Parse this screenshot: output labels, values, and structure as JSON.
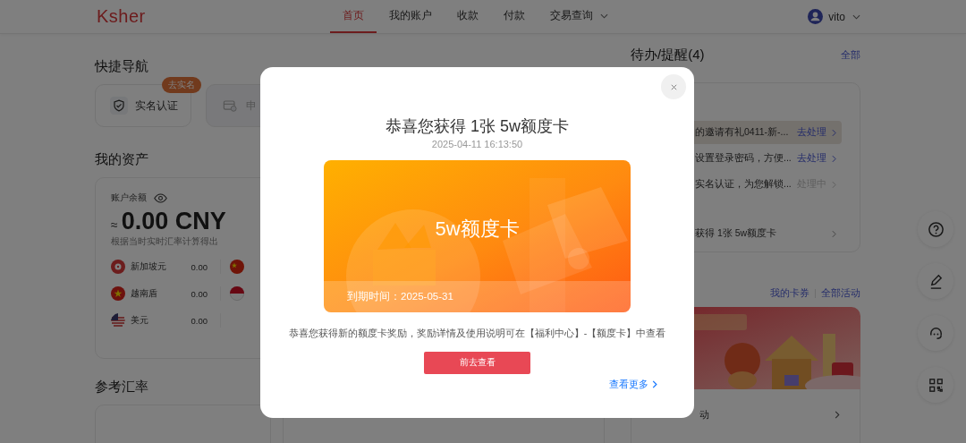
{
  "header": {
    "logo": "Ksher",
    "nav": [
      {
        "label": "首页",
        "selected": true,
        "dropdown": false
      },
      {
        "label": "我的账户",
        "selected": false,
        "dropdown": false
      },
      {
        "label": "收款",
        "selected": false,
        "dropdown": false
      },
      {
        "label": "付款",
        "selected": false,
        "dropdown": false
      },
      {
        "label": "交易查询",
        "selected": false,
        "dropdown": true
      }
    ],
    "user": {
      "name": "vito"
    }
  },
  "quick_nav": {
    "title": "快捷导航",
    "items": [
      {
        "label": "实名认证",
        "badge": "去实名",
        "disabled": false
      },
      {
        "label": "申",
        "disabled": true
      }
    ]
  },
  "assets": {
    "title": "我的资产",
    "balance_label": "账户余额",
    "approx": "≈",
    "balance": "0.00 CNY",
    "note": "根据当时实时汇率计算得出",
    "currencies": [
      {
        "kind": "flower",
        "name": "新加坡元",
        "amount": "0.00"
      },
      {
        "kind": "china"
      },
      {
        "kind": "star",
        "name": "越南盾",
        "amount": "0.00"
      },
      {
        "kind": "halves"
      },
      {
        "kind": "stripes",
        "name": "美元",
        "amount": "0.00"
      }
    ]
  },
  "rates": {
    "title": "参考汇率"
  },
  "todo": {
    "title": "待办/提醒(4)",
    "link": "全部",
    "items": [
      {
        "text": "的邀请有礼0411-新-...",
        "status": "去处理",
        "kind": "action",
        "selected": true
      },
      {
        "text": "设置登录密码，方便...",
        "status": "去处理",
        "kind": "action",
        "selected": false
      },
      {
        "text": "实名认证，为您解锁...",
        "status": "处理中",
        "kind": "pending",
        "selected": false
      },
      {
        "text": "获得 1张 5w额度卡",
        "kind": "plain",
        "selected": false
      }
    ]
  },
  "activities": {
    "links": [
      "我的卡券",
      "全部活动"
    ],
    "items": [
      {
        "label": "动"
      }
    ]
  },
  "modal": {
    "title": "恭喜您获得 1张 5w额度卡",
    "date": "2025-04-11 16:13:50",
    "card_title": "5w额度卡",
    "expiry": "到期时间：2025-05-31",
    "description": "恭喜您获得新的额度卡奖励，奖励详情及使用说明可在【福利中心】-【额度卡】中查看",
    "button": "前去查看",
    "more": "查看更多"
  }
}
